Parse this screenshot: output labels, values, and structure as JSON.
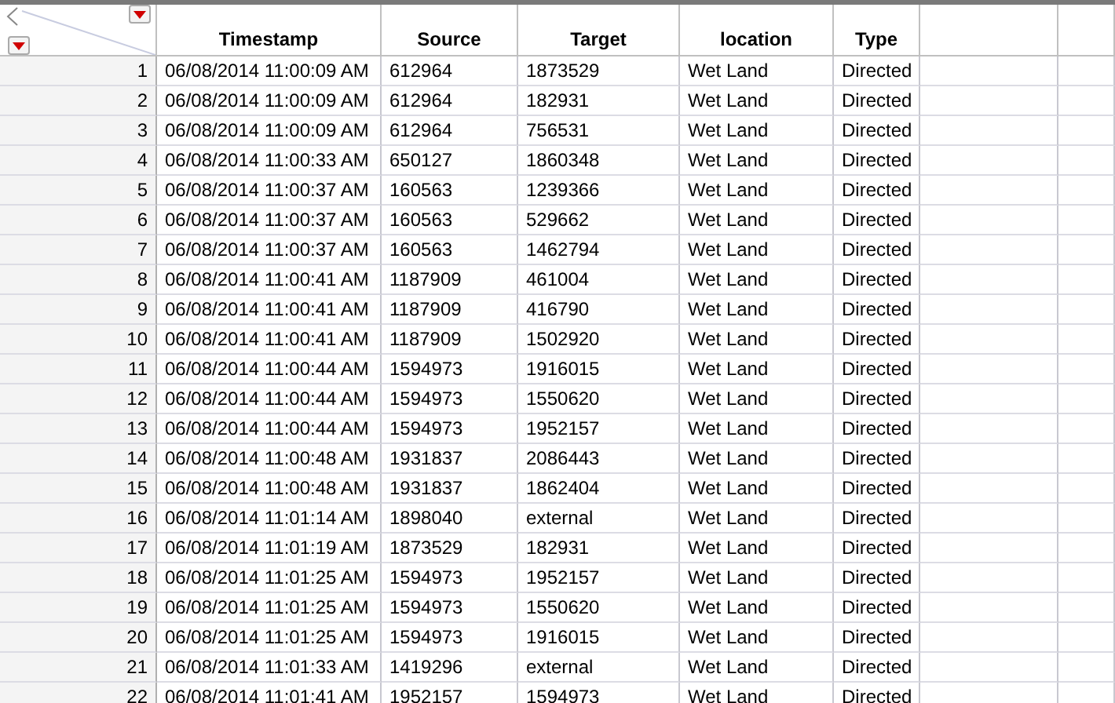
{
  "table": {
    "columns": [
      "Timestamp",
      "Source",
      "Target",
      "location",
      "Type"
    ],
    "rows": [
      {
        "n": "1",
        "cells": [
          "06/08/2014 11:00:09 AM",
          "612964",
          "1873529",
          "Wet Land",
          "Directed"
        ]
      },
      {
        "n": "2",
        "cells": [
          "06/08/2014 11:00:09 AM",
          "612964",
          "182931",
          "Wet Land",
          "Directed"
        ]
      },
      {
        "n": "3",
        "cells": [
          "06/08/2014 11:00:09 AM",
          "612964",
          "756531",
          "Wet Land",
          "Directed"
        ]
      },
      {
        "n": "4",
        "cells": [
          "06/08/2014 11:00:33 AM",
          "650127",
          "1860348",
          "Wet Land",
          "Directed"
        ]
      },
      {
        "n": "5",
        "cells": [
          "06/08/2014 11:00:37 AM",
          "160563",
          "1239366",
          "Wet Land",
          "Directed"
        ]
      },
      {
        "n": "6",
        "cells": [
          "06/08/2014 11:00:37 AM",
          "160563",
          "529662",
          "Wet Land",
          "Directed"
        ]
      },
      {
        "n": "7",
        "cells": [
          "06/08/2014 11:00:37 AM",
          "160563",
          "1462794",
          "Wet Land",
          "Directed"
        ]
      },
      {
        "n": "8",
        "cells": [
          "06/08/2014 11:00:41 AM",
          "1187909",
          "461004",
          "Wet Land",
          "Directed"
        ]
      },
      {
        "n": "9",
        "cells": [
          "06/08/2014 11:00:41 AM",
          "1187909",
          "416790",
          "Wet Land",
          "Directed"
        ]
      },
      {
        "n": "10",
        "cells": [
          "06/08/2014 11:00:41 AM",
          "1187909",
          "1502920",
          "Wet Land",
          "Directed"
        ]
      },
      {
        "n": "11",
        "cells": [
          "06/08/2014 11:00:44 AM",
          "1594973",
          "1916015",
          "Wet Land",
          "Directed"
        ]
      },
      {
        "n": "12",
        "cells": [
          "06/08/2014 11:00:44 AM",
          "1594973",
          "1550620",
          "Wet Land",
          "Directed"
        ]
      },
      {
        "n": "13",
        "cells": [
          "06/08/2014 11:00:44 AM",
          "1594973",
          "1952157",
          "Wet Land",
          "Directed"
        ]
      },
      {
        "n": "14",
        "cells": [
          "06/08/2014 11:00:48 AM",
          "1931837",
          "2086443",
          "Wet Land",
          "Directed"
        ]
      },
      {
        "n": "15",
        "cells": [
          "06/08/2014 11:00:48 AM",
          "1931837",
          "1862404",
          "Wet Land",
          "Directed"
        ]
      },
      {
        "n": "16",
        "cells": [
          "06/08/2014 11:01:14 AM",
          "1898040",
          "external",
          "Wet Land",
          "Directed"
        ]
      },
      {
        "n": "17",
        "cells": [
          "06/08/2014 11:01:19 AM",
          "1873529",
          "182931",
          "Wet Land",
          "Directed"
        ]
      },
      {
        "n": "18",
        "cells": [
          "06/08/2014 11:01:25 AM",
          "1594973",
          "1952157",
          "Wet Land",
          "Directed"
        ]
      },
      {
        "n": "19",
        "cells": [
          "06/08/2014 11:01:25 AM",
          "1594973",
          "1550620",
          "Wet Land",
          "Directed"
        ]
      },
      {
        "n": "20",
        "cells": [
          "06/08/2014 11:01:25 AM",
          "1594973",
          "1916015",
          "Wet Land",
          "Directed"
        ]
      },
      {
        "n": "21",
        "cells": [
          "06/08/2014 11:01:33 AM",
          "1419296",
          "external",
          "Wet Land",
          "Directed"
        ]
      },
      {
        "n": "22",
        "cells": [
          "06/08/2014 11:01:41 AM",
          "1952157",
          "1594973",
          "Wet Land",
          "Directed"
        ]
      }
    ]
  }
}
